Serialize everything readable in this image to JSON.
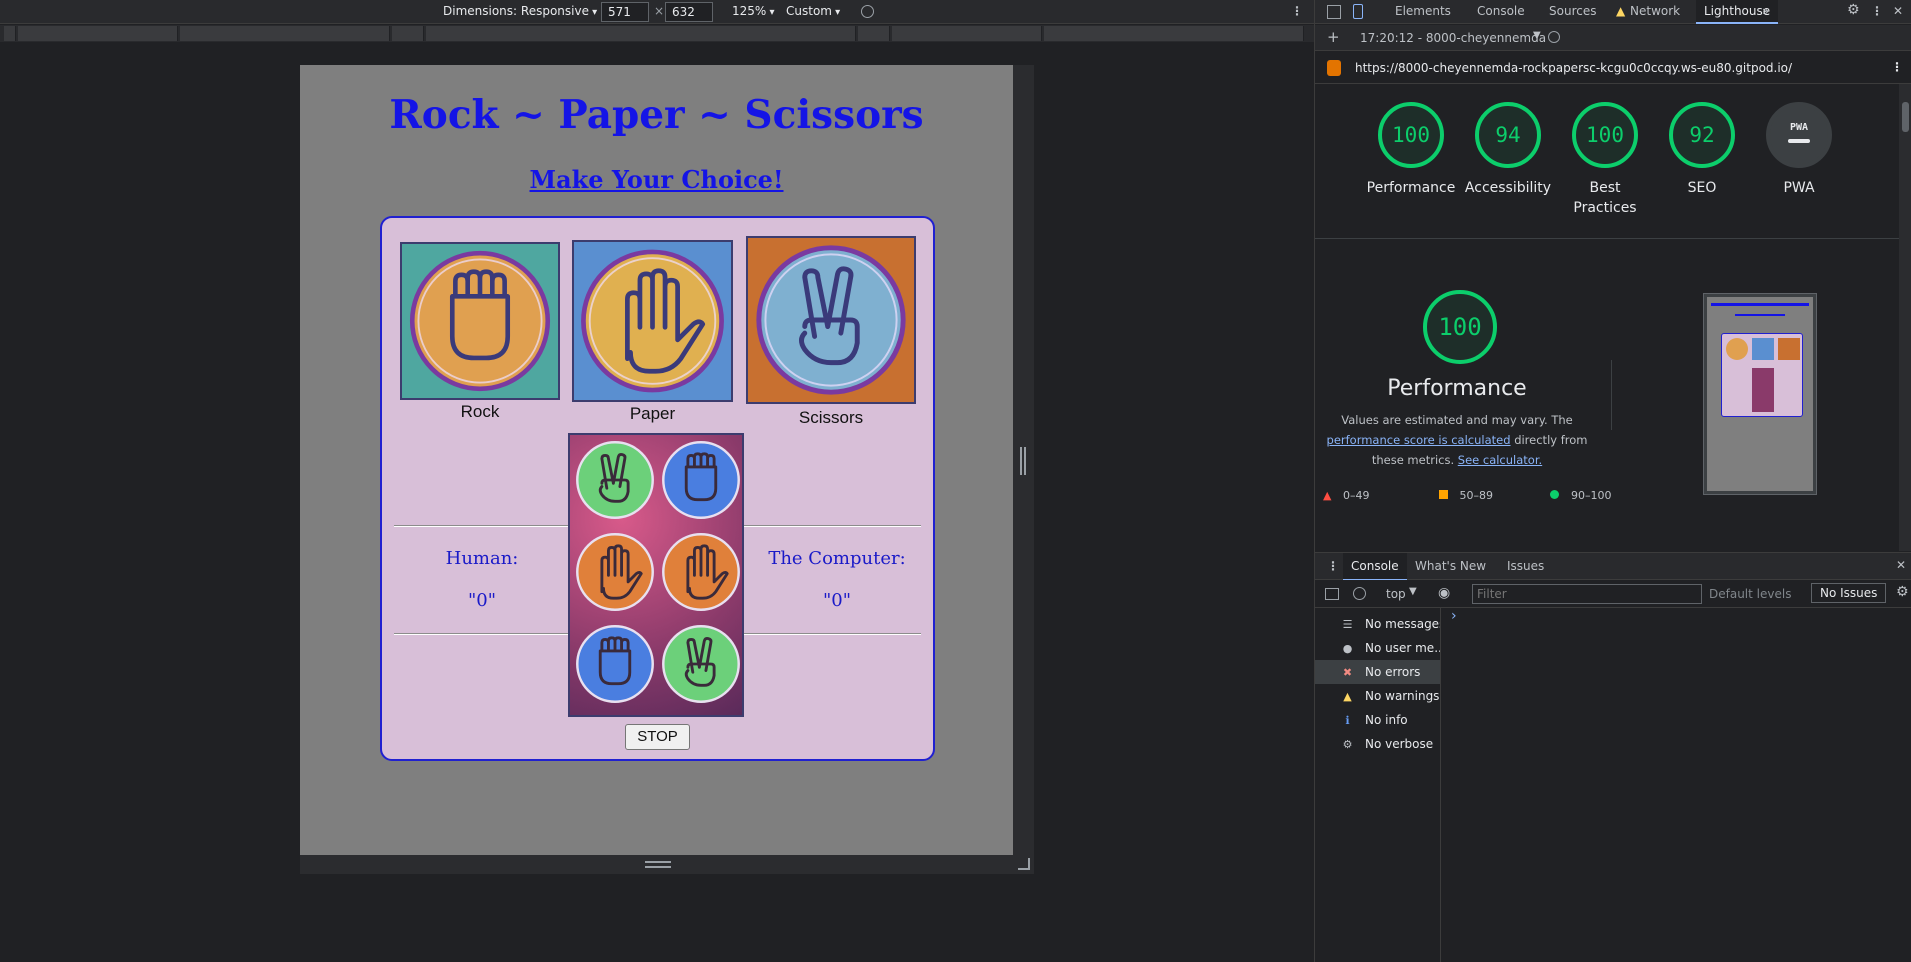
{
  "device_toolbar": {
    "dimensions_label": "Dimensions: Responsive",
    "width_value": "571",
    "times": "×",
    "height_value": "632",
    "zoom": "125%",
    "throttle": "Custom"
  },
  "page": {
    "title": "Rock ~ Paper ~ Scissors",
    "subtitle": "Make Your Choice!",
    "choices": [
      {
        "label": "Rock",
        "icon": "fist-icon",
        "bg": "#4fa7a0",
        "disc": "#e0a050"
      },
      {
        "label": "Paper",
        "icon": "open-hand-icon",
        "bg": "#5a8fd0",
        "disc": "#e0b050"
      },
      {
        "label": "Scissors",
        "icon": "peace-hand-icon",
        "bg": "#c87030",
        "disc": "#7fb0d0"
      }
    ],
    "human_label": "Human:",
    "human_score": "\"0\"",
    "computer_label": "The Computer:",
    "computer_score": "\"0\"",
    "stop_button": "STOP",
    "spinner_colors": [
      "#6cd07a",
      "#4a7ee0",
      "#e0803a",
      "#e0803a",
      "#4a7ee0",
      "#6cd07a"
    ]
  },
  "devtools": {
    "tabs": [
      "Elements",
      "Console",
      "Sources",
      "Network",
      "Lighthouse"
    ],
    "active_tab": "Lighthouse",
    "more": "»",
    "report_select": "17:20:12 - 8000-cheyennemda",
    "url": "https://8000-cheyennemda-rockpapersc-kcgu0c0ccqy.ws-eu80.gitpod.io/",
    "scores": [
      {
        "value": "100",
        "label": "Performance"
      },
      {
        "value": "94",
        "label": "Accessibility"
      },
      {
        "value": "100",
        "label": "Best Practices"
      },
      {
        "value": "92",
        "label": "SEO"
      },
      {
        "value": "PWA",
        "label": "PWA"
      }
    ],
    "perf_score": "100",
    "perf_title": "Performance",
    "perf_desc_1": "Values are estimated and may vary. The",
    "perf_link_1": "performance score is calculated",
    "perf_desc_2": "directly from these metrics.",
    "perf_link_2": "See calculator.",
    "legend": [
      {
        "range": "0–49",
        "color": "#ff4e42"
      },
      {
        "range": "50–89",
        "color": "#ffa400"
      },
      {
        "range": "90–100",
        "color": "#0cce6b"
      }
    ],
    "drawer_tabs": [
      "Console",
      "What's New",
      "Issues"
    ],
    "console_context": "top",
    "filter_placeholder": "Filter",
    "levels": "Default levels",
    "issues": "No Issues",
    "sidebar": [
      {
        "label": "No messages",
        "icon": "list-icon",
        "color": "#bdc1c6"
      },
      {
        "label": "No user me...",
        "icon": "user-icon",
        "color": "#bdc1c6"
      },
      {
        "label": "No errors",
        "icon": "error-icon",
        "color": "#f28b82"
      },
      {
        "label": "No warnings",
        "icon": "warning-icon",
        "color": "#fdd663"
      },
      {
        "label": "No info",
        "icon": "info-icon",
        "color": "#669df6"
      },
      {
        "label": "No verbose",
        "icon": "gear-icon",
        "color": "#bdc1c6"
      }
    ],
    "prompt": "›"
  }
}
